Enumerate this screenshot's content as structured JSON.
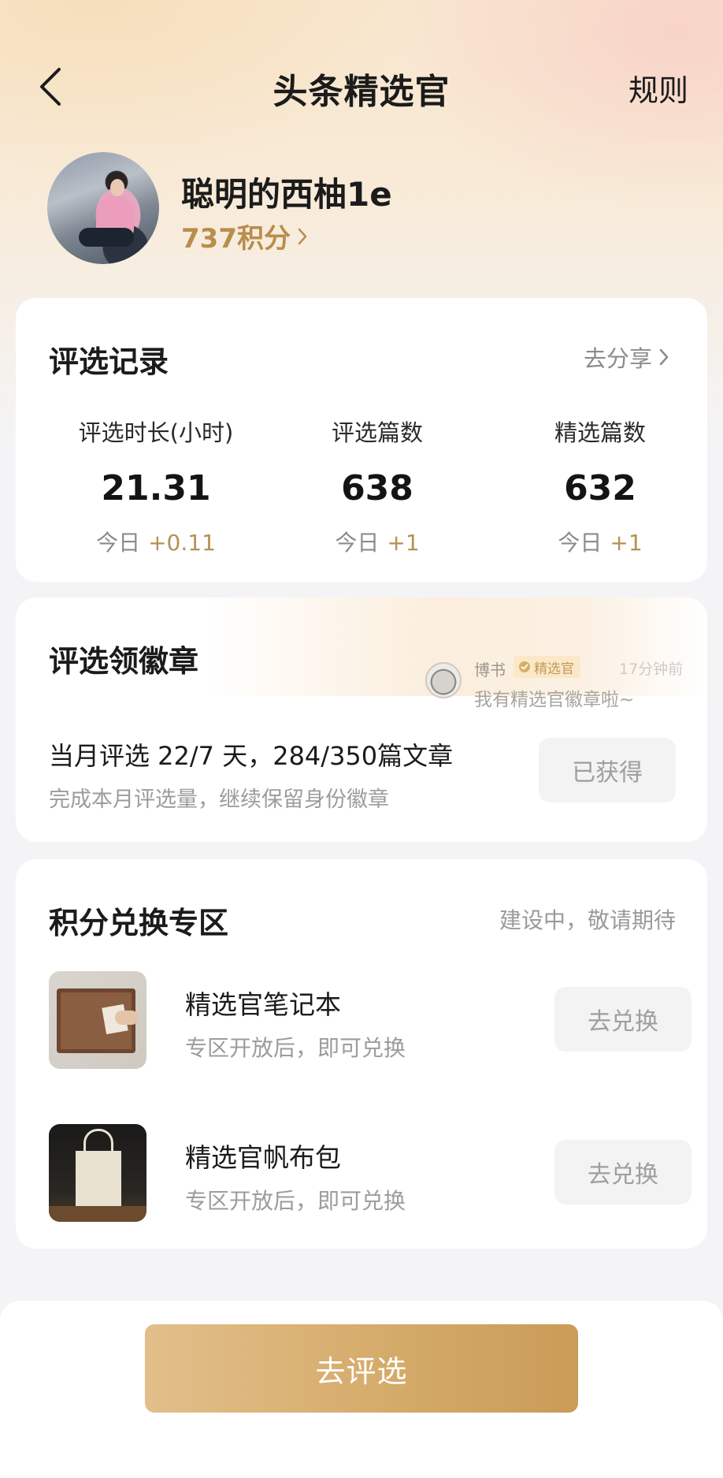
{
  "header": {
    "title": "头条精选官",
    "rules_label": "规则"
  },
  "profile": {
    "username": "聪明的西柚1e",
    "points_label": "737积分"
  },
  "record": {
    "title": "评选记录",
    "share_label": "去分享",
    "stats": [
      {
        "label": "评选时长(小时)",
        "value": "21.31",
        "today_label": "今日",
        "today_delta": "+0.11"
      },
      {
        "label": "评选篇数",
        "value": "638",
        "today_label": "今日",
        "today_delta": "+1"
      },
      {
        "label": "精选篇数",
        "value": "632",
        "today_label": "今日",
        "today_delta": "+1"
      }
    ]
  },
  "badge": {
    "title": "评选领徽章",
    "notification": {
      "name": "博书",
      "tag": "精选官",
      "time": "17分钟前",
      "message": "我有精选官徽章啦~"
    },
    "progress_text": "当月评选 22/7 天，284/350篇文章",
    "sub_text": "完成本月评选量，继续保留身份徽章",
    "button_label": "已获得"
  },
  "exchange": {
    "title": "积分兑换专区",
    "note": "建设中，敬请期待",
    "products": [
      {
        "name": "精选官笔记本",
        "sub": "专区开放后，即可兑换",
        "button": "去兑换"
      },
      {
        "name": "精选官帆布包",
        "sub": "专区开放后，即可兑换",
        "button": "去兑换"
      }
    ]
  },
  "footer": {
    "primary_label": "去评选"
  },
  "colors": {
    "accent_gold": "#b98d4c",
    "delta_gold": "#b59152",
    "button_gold": "#d6ad6d"
  }
}
